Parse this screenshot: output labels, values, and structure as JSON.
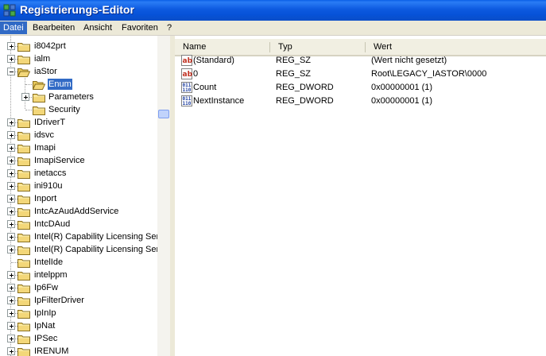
{
  "window": {
    "title": "Registrierungs-Editor"
  },
  "menu": [
    {
      "label": "Datei",
      "active": true
    },
    {
      "label": "Bearbeiten"
    },
    {
      "label": "Ansicht"
    },
    {
      "label": "Favoriten"
    },
    {
      "label": "?"
    }
  ],
  "tree": [
    {
      "label": "i8042prt",
      "level": 0,
      "expander": "plus"
    },
    {
      "label": "ialm",
      "level": 0,
      "expander": "plus"
    },
    {
      "label": "iaStor",
      "level": 0,
      "expander": "minus",
      "open": true
    },
    {
      "label": "Enum",
      "level": 1,
      "expander": "none",
      "selected": true,
      "open": true
    },
    {
      "label": "Parameters",
      "level": 1,
      "expander": "plus"
    },
    {
      "label": "Security",
      "level": 1,
      "expander": "none"
    },
    {
      "label": "IDriverT",
      "level": 0,
      "expander": "plus"
    },
    {
      "label": "idsvc",
      "level": 0,
      "expander": "plus"
    },
    {
      "label": "Imapi",
      "level": 0,
      "expander": "plus"
    },
    {
      "label": "ImapiService",
      "level": 0,
      "expander": "plus"
    },
    {
      "label": "inetaccs",
      "level": 0,
      "expander": "plus"
    },
    {
      "label": "ini910u",
      "level": 0,
      "expander": "plus"
    },
    {
      "label": "Inport",
      "level": 0,
      "expander": "plus"
    },
    {
      "label": "IntcAzAudAddService",
      "level": 0,
      "expander": "plus"
    },
    {
      "label": "IntcDAud",
      "level": 0,
      "expander": "plus"
    },
    {
      "label": "Intel(R) Capability Licensing Serv",
      "level": 0,
      "expander": "plus"
    },
    {
      "label": "Intel(R) Capability Licensing Serv",
      "level": 0,
      "expander": "plus"
    },
    {
      "label": "IntelIde",
      "level": 0,
      "expander": "none"
    },
    {
      "label": "intelppm",
      "level": 0,
      "expander": "plus"
    },
    {
      "label": "Ip6Fw",
      "level": 0,
      "expander": "plus"
    },
    {
      "label": "IpFilterDriver",
      "level": 0,
      "expander": "plus"
    },
    {
      "label": "IpInIp",
      "level": 0,
      "expander": "plus"
    },
    {
      "label": "IpNat",
      "level": 0,
      "expander": "plus"
    },
    {
      "label": "IPSec",
      "level": 0,
      "expander": "plus"
    },
    {
      "label": "IRENUM",
      "level": 0,
      "expander": "plus"
    }
  ],
  "list": {
    "columns": [
      "Name",
      "Typ",
      "Wert"
    ],
    "rows": [
      {
        "icon": "string-value-icon",
        "name": "(Standard)",
        "type": "REG_SZ",
        "data": "(Wert nicht gesetzt)"
      },
      {
        "icon": "string-value-icon",
        "name": "0",
        "type": "REG_SZ",
        "data": "Root\\LEGACY_IASTOR\\0000"
      },
      {
        "icon": "dword-value-icon",
        "name": "Count",
        "type": "REG_DWORD",
        "data": "0x00000001 (1)"
      },
      {
        "icon": "dword-value-icon",
        "name": "NextInstance",
        "type": "REG_DWORD",
        "data": "0x00000001 (1)"
      }
    ]
  },
  "colors": {
    "titlebar": "#0a5fe6",
    "selection": "#316ac5",
    "folder": "#f3d779",
    "ab_red": "#c03020",
    "dword_blue": "#2040a0"
  }
}
